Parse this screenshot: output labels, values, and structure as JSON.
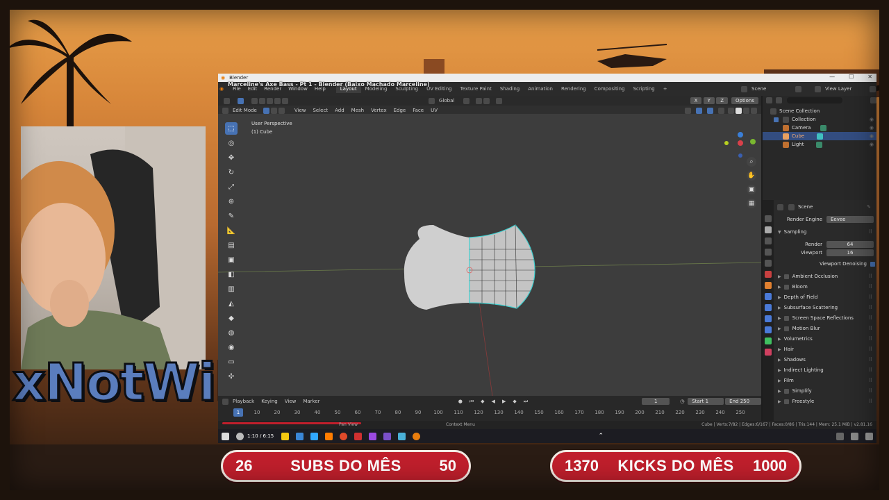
{
  "overlay": {
    "streamer_name": "xNotWillx",
    "subs": {
      "current": "26",
      "label": "SUBS DO MÊS",
      "goal": "50"
    },
    "kicks": {
      "current": "1370",
      "label": "KICKS DO MÊS",
      "goal": "1000"
    }
  },
  "window": {
    "app_title": "Blender",
    "document_title": "Marceline's Axe Bass - Pt 1 - Blender (Baixo Machado Marceline)",
    "controls": [
      "—",
      "☐",
      "✕"
    ]
  },
  "menu": [
    "File",
    "Edit",
    "Render",
    "Window",
    "Help"
  ],
  "workspaces": [
    "Layout",
    "Modeling",
    "Sculpting",
    "UV Editing",
    "Texture Paint",
    "Shading",
    "Animation",
    "Rendering",
    "Compositing",
    "Scripting"
  ],
  "scene_selector": "Scene",
  "view_layer": "View Layer",
  "header": {
    "orientation": "Global",
    "options": "Options",
    "mode": "Edit Mode",
    "items": [
      "View",
      "Select",
      "Add",
      "Mesh",
      "Vertex",
      "Edge",
      "Face",
      "UV"
    ],
    "xyz": [
      "X",
      "Y",
      "Z"
    ]
  },
  "viewport": {
    "perspective": "User Perspective",
    "object": "(1) Cube"
  },
  "timeline": {
    "menus": [
      "Playback",
      "Keying",
      "View",
      "Marker"
    ],
    "current_frame": "1",
    "start_label": "Start",
    "start": "1",
    "end_label": "End",
    "end": "250",
    "ticks": [
      "10",
      "20",
      "30",
      "40",
      "50",
      "60",
      "70",
      "80",
      "90",
      "100",
      "110",
      "120",
      "130",
      "140",
      "150",
      "160",
      "170",
      "180",
      "190",
      "200",
      "210",
      "220",
      "230",
      "240",
      "250"
    ],
    "playhead": "1"
  },
  "status": {
    "pan_view": "Pan View",
    "context_menu": "Context Menu",
    "stats": "Cube | Verts:7/82 | Edges:6/167 | Faces:0/86 | Tris:144 | Mem: 25.1 MiB | v2.81.16",
    "video_time": "1:10 / 6:15"
  },
  "outliner": {
    "root": "Scene Collection",
    "items": [
      {
        "label": "Collection"
      },
      {
        "label": "Camera"
      },
      {
        "label": "Cube"
      },
      {
        "label": "Light"
      }
    ]
  },
  "properties": {
    "context": "Scene",
    "render_engine_label": "Render Engine",
    "render_engine": "Eevee",
    "sampling": "Sampling",
    "render_label": "Render",
    "render_value": "64",
    "viewport_label": "Viewport",
    "viewport_value": "16",
    "denoise_label": "Viewport Denoising",
    "panels": [
      {
        "label": "Ambient Occlusion",
        "checkbox": true
      },
      {
        "label": "Bloom",
        "checkbox": true
      },
      {
        "label": "Depth of Field",
        "checkbox": false
      },
      {
        "label": "Subsurface Scattering",
        "checkbox": false
      },
      {
        "label": "Screen Space Reflections",
        "checkbox": true
      },
      {
        "label": "Motion Blur",
        "checkbox": true
      },
      {
        "label": "Volumetrics",
        "checkbox": false
      },
      {
        "label": "Hair",
        "checkbox": false
      },
      {
        "label": "Shadows",
        "checkbox": false
      },
      {
        "label": "Indirect Lighting",
        "checkbox": false
      },
      {
        "label": "Film",
        "checkbox": false
      },
      {
        "label": "Simplify",
        "checkbox": true
      },
      {
        "label": "Freestyle",
        "checkbox": true
      }
    ]
  },
  "colors": {
    "accent": "#4772b3",
    "selection": "#334d80",
    "counter_red": "#c01f2c",
    "edit_cyan": "#3fd0d0"
  }
}
